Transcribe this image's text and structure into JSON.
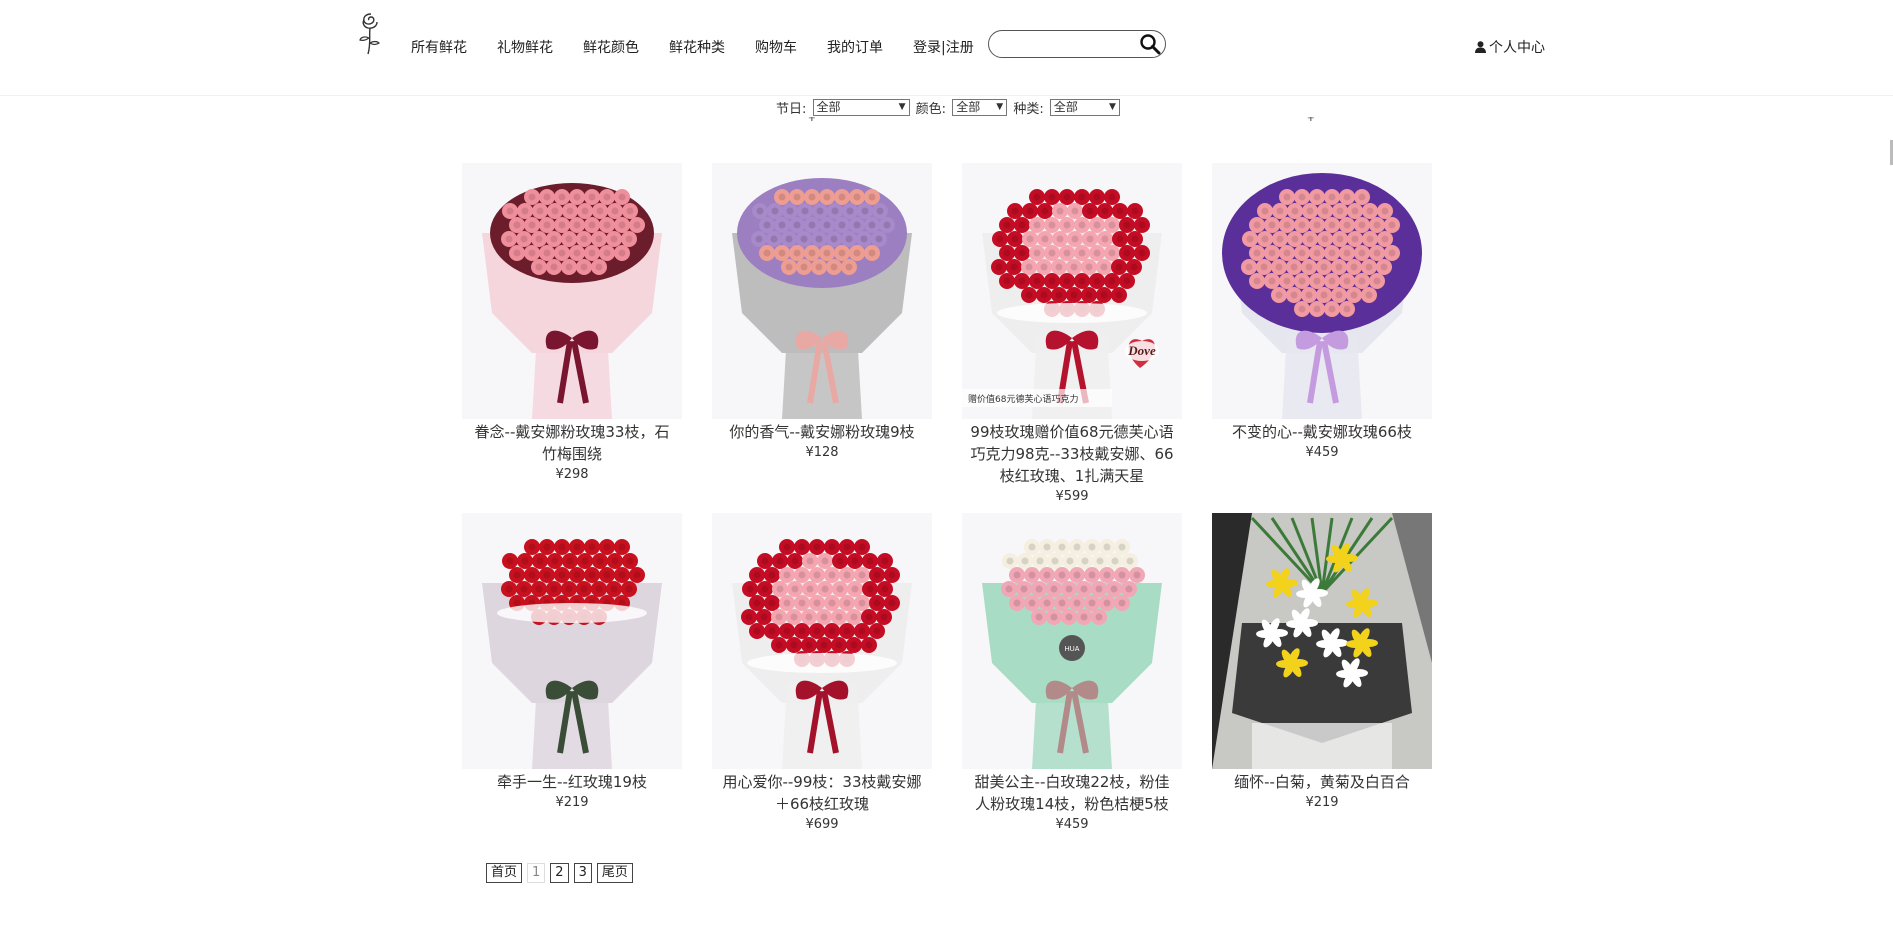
{
  "header": {
    "nav": [
      {
        "label": "所有鲜花"
      },
      {
        "label": "礼物鲜花"
      },
      {
        "label": "鲜花颜色"
      },
      {
        "label": "鲜花种类"
      },
      {
        "label": "购物车"
      },
      {
        "label": "我的订单"
      },
      {
        "label": "登录|注册"
      }
    ],
    "search": {
      "value": "",
      "placeholder": ""
    },
    "user_center": "个人中心"
  },
  "filters": {
    "festival_label": "节日:",
    "festival_value": "全部",
    "color_label": "颜色:",
    "color_value": "全部",
    "type_label": "种类:",
    "type_value": "全部"
  },
  "products": [
    {
      "name": "眷念--戴安娜粉玫瑰33枝，石竹梅围绕",
      "price": "¥298",
      "flower": "pink-roses",
      "ribbon": "#7a1530",
      "wrap": "#f4d6dc"
    },
    {
      "name": "你的香气--戴安娜粉玫瑰9枝",
      "price": "¥128",
      "flower": "pink-roses-purple",
      "ribbon": "#e8a9a4",
      "wrap": "#bdbdbd"
    },
    {
      "name": "99枝玫瑰赠价值68元德芙心语巧克力98克--33枝戴安娜、66枝红玫瑰、1扎满天星",
      "price": "¥599",
      "flower": "heart-red",
      "ribbon": "#b5122d",
      "wrap": "#eeeeee"
    },
    {
      "name": "不变的心--戴安娜玫瑰66枝",
      "price": "¥459",
      "flower": "pink-big",
      "ribbon": "#c59be0",
      "wrap": "#e6e6ee"
    },
    {
      "name": "牵手一生--红玫瑰19枝",
      "price": "¥219",
      "flower": "red-roses",
      "ribbon": "#3a4d36",
      "wrap": "#ded6de"
    },
    {
      "name": "用心爱你--99枝：33枝戴安娜＋66枝红玫瑰",
      "price": "¥699",
      "flower": "heart-red",
      "ribbon": "#a3122a",
      "wrap": "#eeeeee"
    },
    {
      "name": "甜美公主--白玫瑰22枝，粉佳人粉玫瑰14枝，粉色桔梗5枝",
      "price": "¥459",
      "flower": "mixed-pink",
      "ribbon": "#b28a8a",
      "wrap": "#a9dcc4"
    },
    {
      "name": "缅怀--白菊，黄菊及白百合",
      "price": "¥219",
      "flower": "lilies",
      "ribbon": "#ffffff",
      "wrap": "#3a3a3a"
    }
  ],
  "pagination": {
    "first": "首页",
    "pages": [
      "1",
      "2",
      "3"
    ],
    "current": "1",
    "last": "尾页"
  },
  "chocolate_badge": {
    "brand": "Dove",
    "caption": "赠价值68元德芙心语巧克力"
  },
  "wrap_label": "HUA"
}
